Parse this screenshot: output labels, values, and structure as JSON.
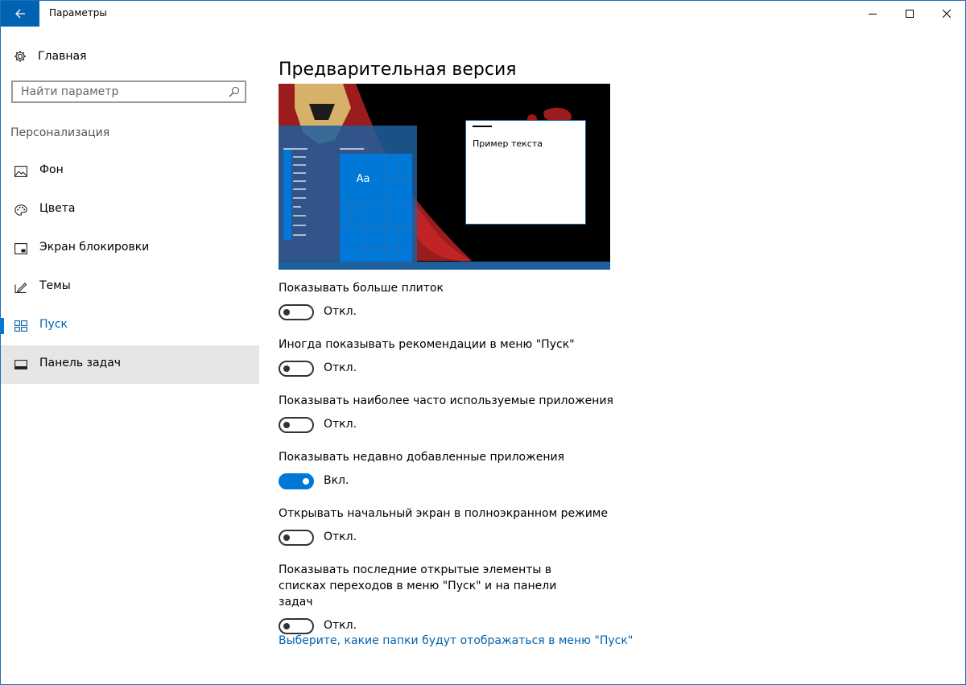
{
  "window": {
    "title": "Параметры"
  },
  "sidebar": {
    "home_label": "Главная",
    "search_placeholder": "Найти параметр",
    "section_title": "Персонализация",
    "items": [
      {
        "label": "Фон",
        "icon": "picture-icon"
      },
      {
        "label": "Цвета",
        "icon": "palette-icon"
      },
      {
        "label": "Экран блокировки",
        "icon": "lock-screen-icon"
      },
      {
        "label": "Темы",
        "icon": "themes-icon"
      },
      {
        "label": "Пуск",
        "icon": "start-icon",
        "active": true
      },
      {
        "label": "Панель задач",
        "icon": "taskbar-icon",
        "hover": true
      }
    ]
  },
  "main": {
    "title": "Предварительная версия",
    "preview": {
      "tile_text": "Aa",
      "sample_text": "Пример текста"
    },
    "toggles": [
      {
        "label": "Показывать больше плиток",
        "state": "Откл.",
        "on": false
      },
      {
        "label": "Иногда показывать рекомендации в меню \"Пуск\"",
        "state": "Откл.",
        "on": false
      },
      {
        "label": "Показывать наиболее часто используемые приложения",
        "state": "Откл.",
        "on": false
      },
      {
        "label": "Показывать недавно добавленные приложения",
        "state": "Вкл.",
        "on": true
      },
      {
        "label": "Открывать начальный экран в полноэкранном режиме",
        "state": "Откл.",
        "on": false
      },
      {
        "label": "Показывать последние открытые элементы в списках переходов в меню \"Пуск\" и на панели задач",
        "state": "Откл.",
        "on": false
      }
    ],
    "link": "Выберите, какие папки будут отображаться в меню \"Пуск\""
  },
  "colors": {
    "accent": "#0078d7",
    "title_back": "#0063b1",
    "hover_bg": "#e6e6e6"
  }
}
